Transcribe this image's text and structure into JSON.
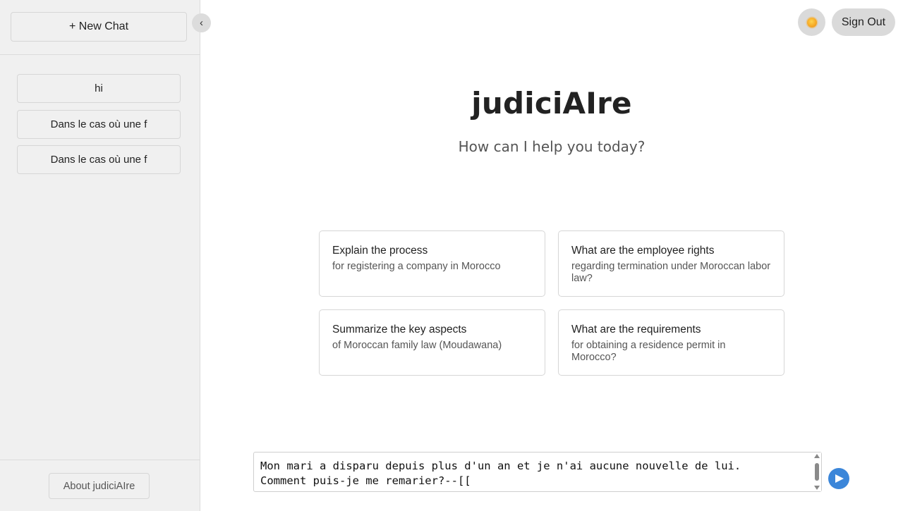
{
  "sidebar": {
    "new_chat_label": "+ New Chat",
    "history": [
      {
        "label": "hi"
      },
      {
        "label": "Dans le cas où une f"
      },
      {
        "label": "Dans le cas où une f"
      }
    ],
    "about_label": "About judiciAIre",
    "collapse_glyph": "‹"
  },
  "header": {
    "theme_icon": "sun-icon",
    "signout_label": "Sign Out"
  },
  "hero": {
    "brand": "judiciAIre",
    "tagline": "How can I help you today?"
  },
  "suggestions": [
    {
      "title": "Explain the process",
      "subtitle": "for registering a company in Morocco"
    },
    {
      "title": "What are the employee rights",
      "subtitle": "regarding termination under Moroccan labor law?"
    },
    {
      "title": "Summarize the key aspects",
      "subtitle": "of Moroccan family law (Moudawana)"
    },
    {
      "title": "What are the requirements",
      "subtitle": "for obtaining a residence permit in Morocco?"
    }
  ],
  "composer": {
    "value": "Mon mari a disparu depuis plus d'un an et je n'ai aucune nouvelle de lui.\nComment puis-je me remarier?--[["
  },
  "colors": {
    "sidebar_bg": "#f0f0f0",
    "send_button": "#3b86d9",
    "pill_bg": "#dadada"
  }
}
